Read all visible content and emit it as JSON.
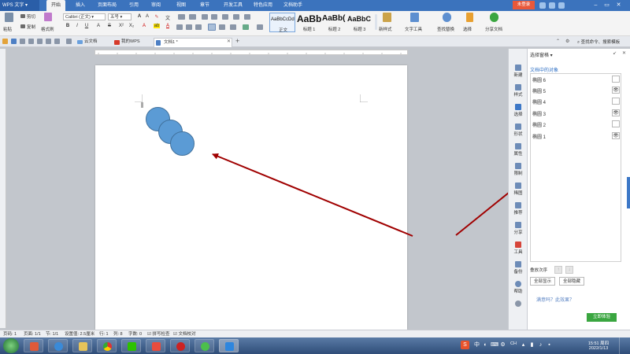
{
  "app": {
    "name": "WPS 文字",
    "login": "未登录"
  },
  "menu": [
    "开始",
    "插入",
    "页面布局",
    "引用",
    "审阅",
    "视图",
    "章节",
    "开发工具",
    "特色应用",
    "文档助手"
  ],
  "ribbon": {
    "paste": "粘贴",
    "cut": "剪切",
    "copy": "复制",
    "format_painter": "格式刷",
    "font_name": "Calibri (正文)",
    "font_size": "五号",
    "styles": [
      {
        "preview": "AaBbCcDd",
        "name": "正文"
      },
      {
        "preview": "AaBb",
        "name": "标题 1"
      },
      {
        "preview": "AaBb(",
        "name": "标题 2"
      },
      {
        "preview": "AaBbC",
        "name": "标题 3"
      }
    ],
    "new_style": "新样式",
    "text_tools": "文字工具",
    "find_replace": "查找替换",
    "select": "选择",
    "share_doc": "分享文档",
    "search_commands": "查找命令、搜索模板"
  },
  "tabs": [
    {
      "label": "云文档"
    },
    {
      "label": "我的WPS"
    },
    {
      "label": "文档1 *"
    }
  ],
  "side_tools": [
    "新建",
    "样式",
    "选择",
    "形状",
    "属性",
    "限制",
    "稀图",
    "推荐",
    "分享",
    "工具",
    "备份",
    "帮助"
  ],
  "pane": {
    "title": "选择窗格",
    "section": "文档中的对象",
    "objects": [
      {
        "name": "椭圆 6",
        "visible": false
      },
      {
        "name": "椭圆 5",
        "visible": true
      },
      {
        "name": "椭圆 4",
        "visible": false
      },
      {
        "name": "椭圆 3",
        "visible": true
      },
      {
        "name": "椭圆 2",
        "visible": false
      },
      {
        "name": "椭圆 1",
        "visible": true
      }
    ],
    "order_label": "叠放次序",
    "show_all": "全部显示",
    "hide_all": "全部隐藏",
    "bottom_text": "满意吗？此效果？",
    "experience": "立即体验"
  },
  "status": {
    "page": "页码: 1",
    "pages": "页面: 1/1",
    "section": "节: 1/1",
    "setting": "设置值: 2.5厘米",
    "row": "行: 1",
    "col": "列: 8",
    "words": "字数: 0",
    "spell": "拼写检查",
    "proof": "文档校对"
  },
  "clock": {
    "time": "15:51",
    "weekday": "周四",
    "date": "2022/1/13"
  },
  "ime": "中",
  "colors": {
    "accent": "#3b73bd",
    "arrow": "#a00000",
    "shape_fill": "#5b9bd5",
    "shape_border": "#41719c",
    "login": "#e8583a",
    "experience": "#3aa640"
  }
}
